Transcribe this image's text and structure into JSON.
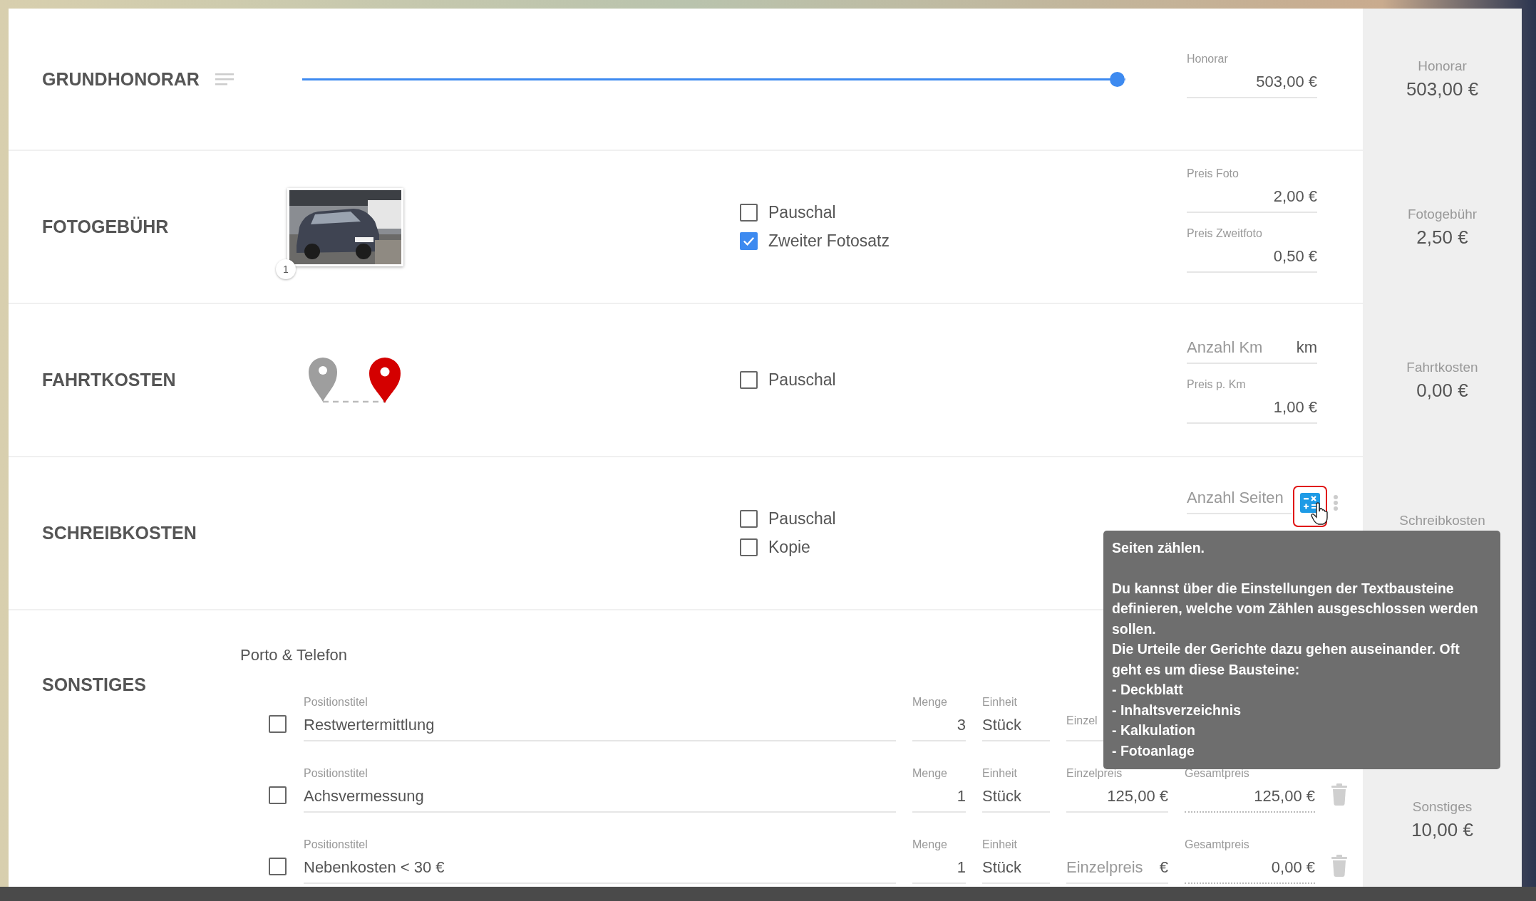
{
  "sections": [
    {
      "kind": "slider",
      "title": "GRUNDHONORAR",
      "slider": {
        "level": 0.99
      },
      "fields": [
        {
          "label": "Honorar",
          "value": "503,00 €"
        }
      ],
      "summary": {
        "label": "Honorar",
        "value": "503,00 €"
      }
    },
    {
      "kind": "photos",
      "title": "FOTOGEBÜHR",
      "photo_count": "1",
      "options": [
        {
          "label": "Pauschal",
          "checked": false
        },
        {
          "label": "Zweiter Fotosatz",
          "checked": true
        }
      ],
      "fields": [
        {
          "label": "Preis Foto",
          "value": "2,00 €"
        },
        {
          "label": "Preis Zweitfoto",
          "value": "0,50 €"
        }
      ],
      "summary": {
        "label": "Fotogebühr",
        "value": "2,50 €"
      }
    },
    {
      "kind": "route",
      "title": "FAHRTKOSTEN",
      "options": [
        {
          "label": "Pauschal",
          "checked": false
        }
      ],
      "fields": [
        {
          "placeholder": "Anzahl Km",
          "suffix": "km"
        },
        {
          "label": "Preis p. Km",
          "value": "1,00 €"
        }
      ],
      "summary": {
        "label": "Fahrtkosten",
        "value": "0,00 €"
      }
    },
    {
      "kind": "plain",
      "title": "SCHREIBKOSTEN",
      "options": [
        {
          "label": "Pauschal",
          "checked": false
        },
        {
          "label": "Kopie",
          "checked": false
        }
      ],
      "fields": [
        {
          "placeholder": "Anzahl Seiten",
          "kind": "calculator"
        }
      ],
      "summary": {
        "label": "Schreibkosten"
      }
    },
    {
      "kind": "items",
      "title": "SONSTIGES",
      "group": "Porto & Telefon",
      "items": [
        {
          "checked": false,
          "fields": [
            {
              "kind": "title",
              "label": "Positionstitel",
              "value": "Restwertermittlung"
            },
            {
              "kind": "qty",
              "label": "Menge",
              "value": "3"
            },
            {
              "kind": "unit",
              "label": "Einheit",
              "value": "Stück"
            },
            {
              "kind": "price",
              "label": "Einzel"
            }
          ]
        },
        {
          "checked": false,
          "fields": [
            {
              "kind": "title",
              "label": "Positionstitel",
              "value": "Achsvermessung"
            },
            {
              "kind": "qty",
              "label": "Menge",
              "value": "1"
            },
            {
              "kind": "unit",
              "label": "Einheit",
              "value": "Stück"
            },
            {
              "kind": "price",
              "label": "Einzelpreis",
              "value": "125,00 €"
            },
            {
              "kind": "total",
              "label": "Gesamtpreis",
              "value": "125,00 €"
            }
          ]
        },
        {
          "checked": false,
          "fields": [
            {
              "kind": "title",
              "label": "Positionstitel",
              "value": "Nebenkosten < 30 €"
            },
            {
              "kind": "qty",
              "label": "Menge",
              "value": "1"
            },
            {
              "kind": "unit",
              "label": "Einheit",
              "value": "Stück"
            },
            {
              "kind": "price",
              "placeholder": "Einzelpreis",
              "suffix": "€"
            },
            {
              "kind": "total",
              "label": "Gesamtpreis",
              "value": "0,00 €"
            }
          ]
        }
      ],
      "summary": {
        "label": "Sonstiges",
        "value": "10,00 €"
      }
    }
  ],
  "tooltip": {
    "title": "Seiten zählen.",
    "paragraphs": [
      "Du kannst über die Einstellungen der Textbausteine definieren, welche vom Zählen ausgeschlossen werden sollen.",
      "Die Urteile der Gerichte dazu gehen auseinander. Oft geht es um diese Bausteine:"
    ],
    "items": [
      "- Deckblatt",
      "- Inhaltsverzeichnis",
      "- Kalkulation",
      "- Fotoanlage"
    ]
  }
}
